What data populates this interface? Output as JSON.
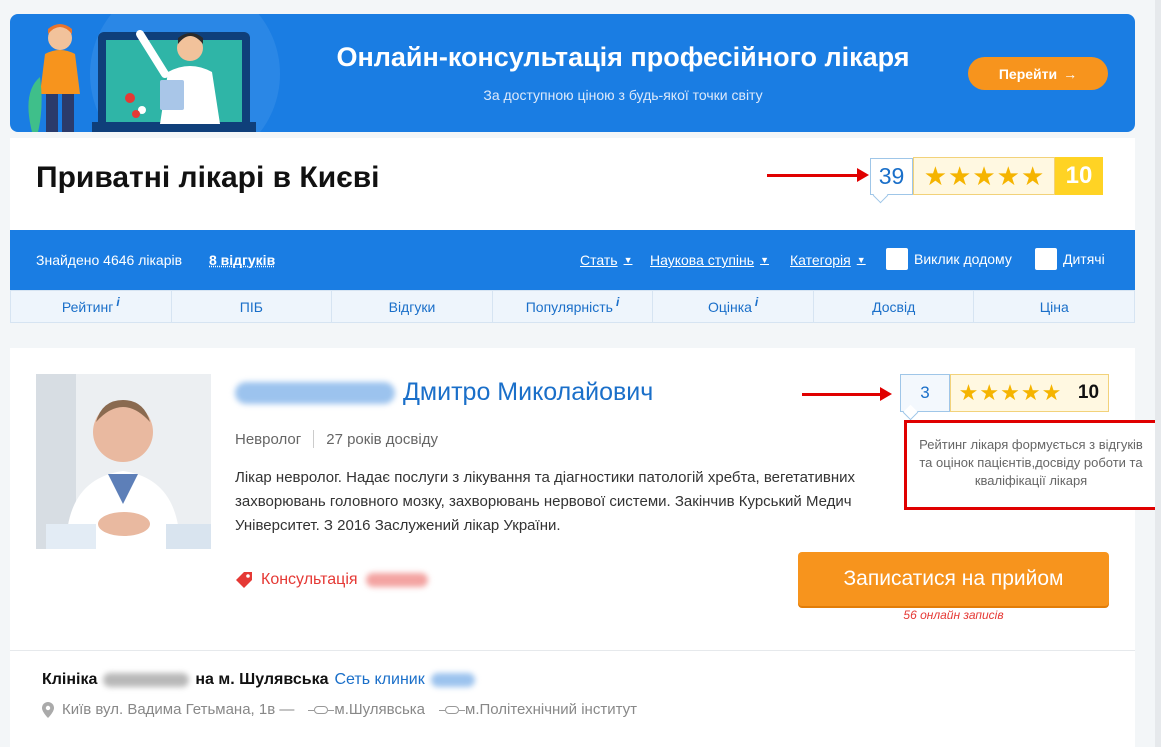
{
  "banner": {
    "title": "Онлайн-консультація професійного лікаря",
    "subtitle": "За доступною ціною з будь-якої точки світу",
    "button_label": "Перейти",
    "button_arrow": "→"
  },
  "page": {
    "title": "Приватні лікарі в Києві",
    "reviews_count": "39",
    "rating_score": "10",
    "stars": 5
  },
  "filters": {
    "found_text": "Знайдено 4646 лікарів",
    "reviews_link": "8 відгуків",
    "gender": "Стать",
    "degree": "Наукова ступінь",
    "category": "Категорія",
    "home_visit": "Виклик додому",
    "children": "Дитячі",
    "caret": "▼"
  },
  "sort": [
    {
      "label": "Рейтинг",
      "info": "i"
    },
    {
      "label": "ПІБ",
      "info": ""
    },
    {
      "label": "Відгуки",
      "info": ""
    },
    {
      "label": "Популярність",
      "info": "i"
    },
    {
      "label": "Оцінка",
      "info": "i"
    },
    {
      "label": "Досвід",
      "info": ""
    },
    {
      "label": "Ціна",
      "info": ""
    }
  ],
  "doctor": {
    "name_visible": "Дмитро Миколайович",
    "specialty": "Невролог",
    "experience": "27 років досвіду",
    "description": "Лікар невролог. Надає послуги з лікування та діагностики патологій хребта, вегетативних захворювань головного мозку, захворювань нервової системи. Закінчив Курський Медич Університет. З 2016 Заслужений лікар України.",
    "reviews_count": "3",
    "rating_score": "10",
    "stars": 5,
    "consult_label": "Консультація",
    "cta_label": "Записатися на прийом",
    "online_text": "56 онлайн записів",
    "tooltip": "Рейтинг лікаря формується з відгуків та оцінок пацієнтів,досвіду роботи та кваліфікації лікаря"
  },
  "clinic": {
    "name_prefix": "Клініка",
    "name_suffix": "на м. Шулявська",
    "network": "Сеть клиник",
    "address": "Київ вул. Вадима Гетьмана, 1в —",
    "metro1": "м.Шулявська",
    "metro2": "м.Політехнічний інститут"
  },
  "colors": {
    "brand_blue": "#1a7de3",
    "link_blue": "#1a6fc9",
    "orange": "#f7941d",
    "star": "#f5b400",
    "score": "#ffd324",
    "red": "#e53935"
  }
}
